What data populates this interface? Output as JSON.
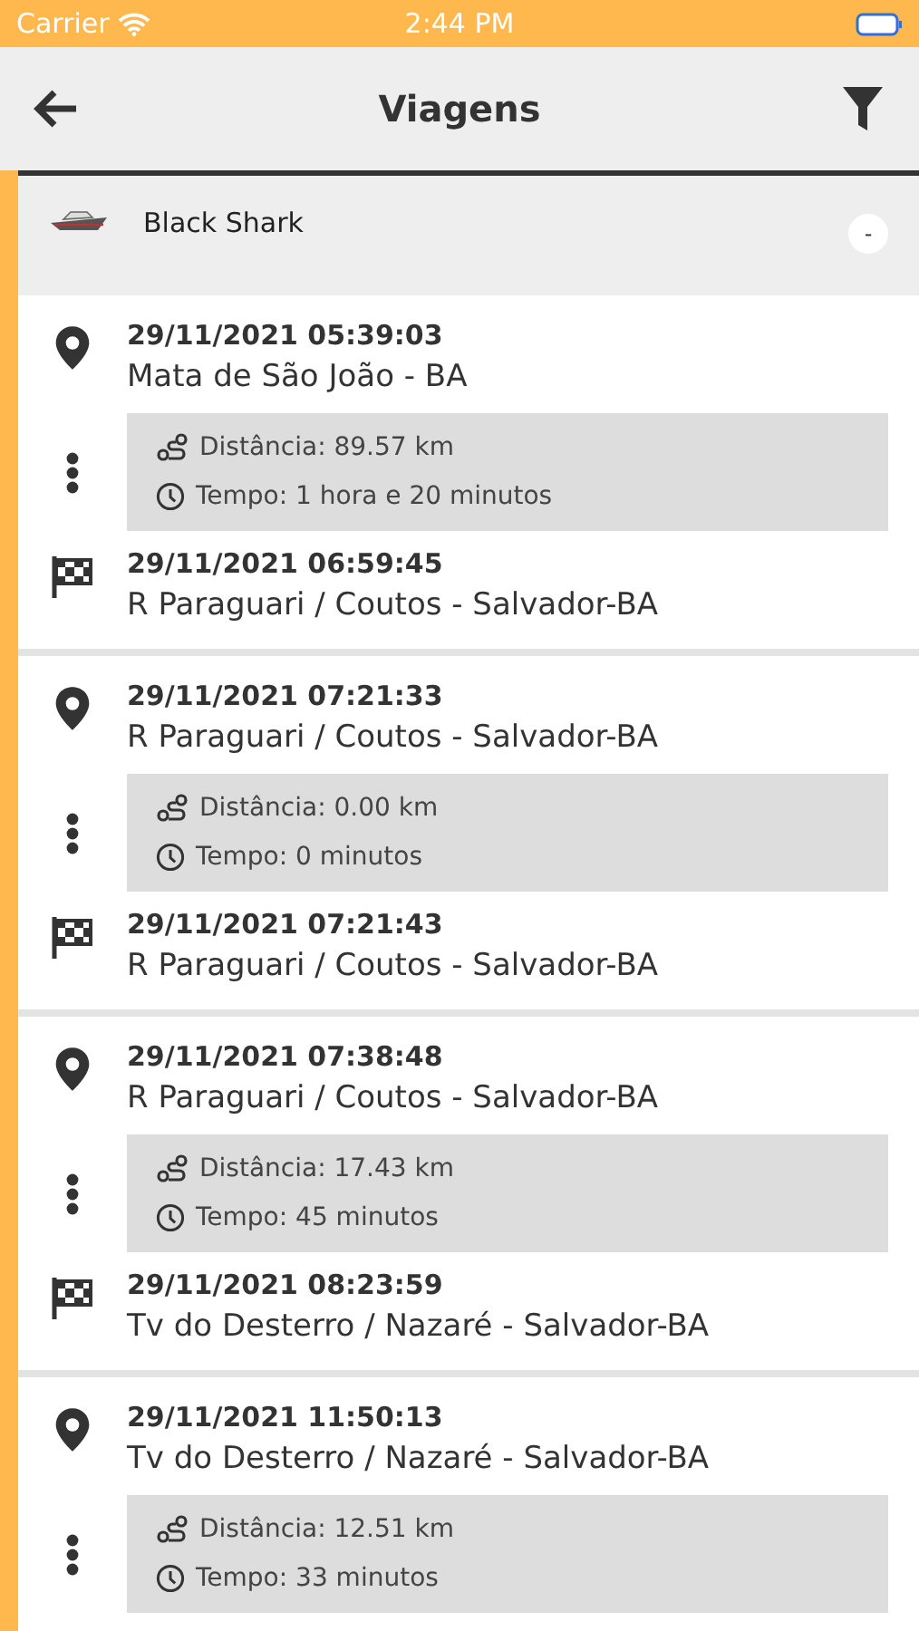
{
  "status_bar": {
    "carrier": "Carrier",
    "time": "2:44 PM"
  },
  "header": {
    "title": "Viagens"
  },
  "vehicle": {
    "name": "Black Shark",
    "toggle": "-",
    "expanded": true
  },
  "trips": [
    {
      "start": {
        "datetime": "29/11/2021 05:39:03",
        "address": "Mata de São João - BA"
      },
      "distance": "Distância: 89.57 km",
      "duration": "Tempo: 1 hora e 20 minutos",
      "end": {
        "datetime": "29/11/2021 06:59:45",
        "address": "R Paraguari / Coutos - Salvador-BA"
      }
    },
    {
      "start": {
        "datetime": "29/11/2021 07:21:33",
        "address": "R Paraguari / Coutos - Salvador-BA"
      },
      "distance": "Distância: 0.00 km",
      "duration": "Tempo: 0 minutos",
      "end": {
        "datetime": "29/11/2021 07:21:43",
        "address": "R Paraguari / Coutos - Salvador-BA"
      }
    },
    {
      "start": {
        "datetime": "29/11/2021 07:38:48",
        "address": "R Paraguari / Coutos - Salvador-BA"
      },
      "distance": "Distância: 17.43 km",
      "duration": "Tempo: 45 minutos",
      "end": {
        "datetime": "29/11/2021 08:23:59",
        "address": "Tv do Desterro / Nazaré - Salvador-BA"
      }
    },
    {
      "start": {
        "datetime": "29/11/2021 11:50:13",
        "address": "Tv do Desterro / Nazaré - Salvador-BA"
      },
      "distance": "Distância: 12.51 km",
      "duration": "Tempo: 33 minutos"
    }
  ]
}
